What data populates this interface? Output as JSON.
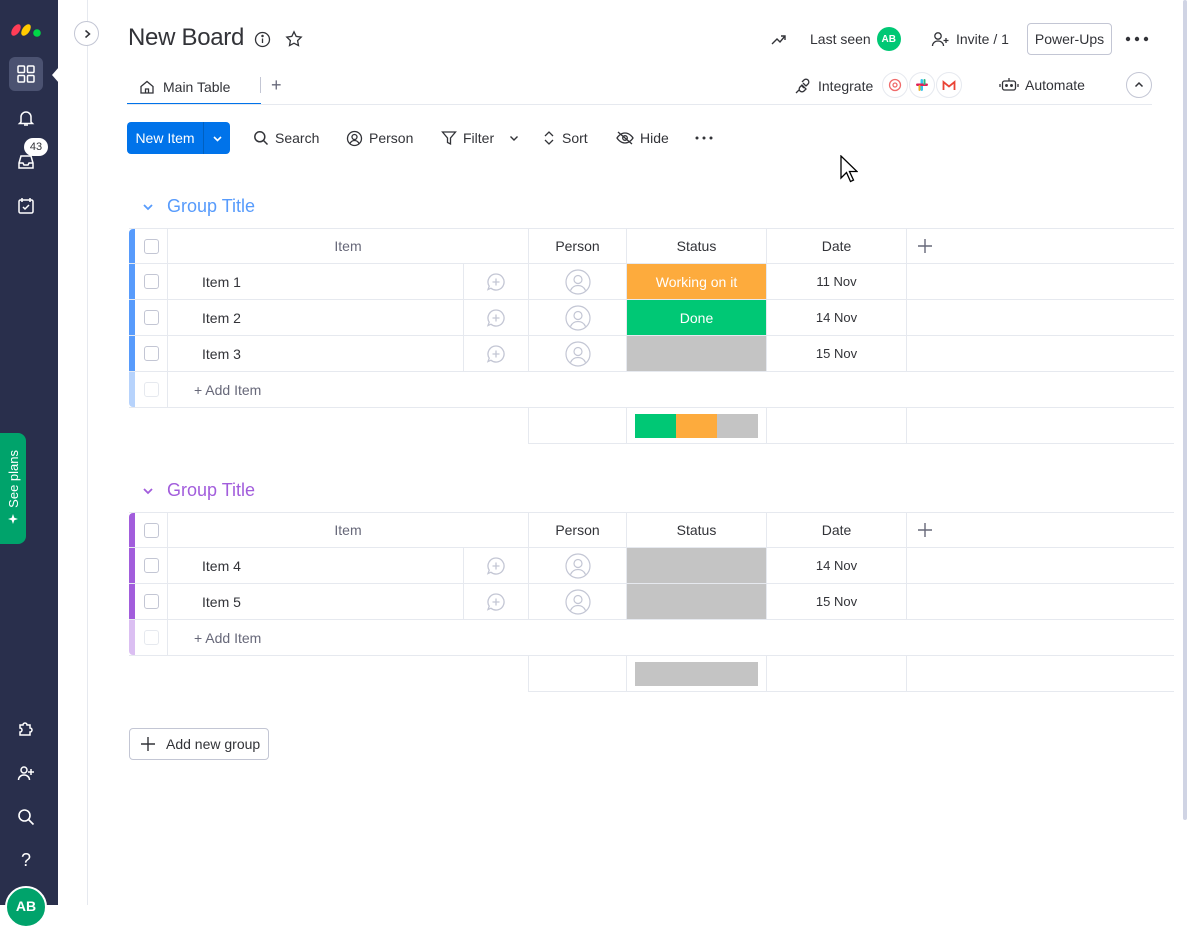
{
  "sidebar": {
    "logo": "monday-logo",
    "items": [
      {
        "name": "workspace-grid-icon",
        "active": true
      },
      {
        "name": "bell-icon"
      },
      {
        "name": "inbox-icon",
        "badge": "43"
      },
      {
        "name": "my-work-calendar-icon"
      }
    ],
    "see_plans": "See plans",
    "bottom_items": [
      "puzzle-icon",
      "invite-members-icon",
      "search-icon",
      "help-icon"
    ],
    "avatar_initials": "AB"
  },
  "board": {
    "title": "New Board",
    "last_seen_label": "Last seen",
    "last_seen_avatar": "AB",
    "invite_label": "Invite / 1",
    "power_ups_label": "Power-Ups"
  },
  "tabs": {
    "main_label": "Main Table",
    "add_label": "+",
    "integrate_label": "Integrate",
    "automate_label": "Automate"
  },
  "toolbar": {
    "new_item": "New Item",
    "search": "Search",
    "person": "Person",
    "filter": "Filter",
    "sort": "Sort",
    "hide": "Hide"
  },
  "columns": {
    "item": "Item",
    "person": "Person",
    "status": "Status",
    "date": "Date"
  },
  "groups": [
    {
      "title": "Group Title",
      "color": "#579bfc",
      "add_item": "+ Add Item",
      "rows": [
        {
          "name": "Item 1",
          "status": "Working on it",
          "status_color": "#fdab3d",
          "date": "11 Nov"
        },
        {
          "name": "Item 2",
          "status": "Done",
          "status_color": "#00c875",
          "date": "14 Nov"
        },
        {
          "name": "Item 3",
          "status": "",
          "status_color": "#c4c4c4",
          "date": "15 Nov"
        }
      ],
      "status_summary": [
        {
          "color": "#00c875",
          "fraction": 0.3333
        },
        {
          "color": "#fdab3d",
          "fraction": 0.3333
        },
        {
          "color": "#c4c4c4",
          "fraction": 0.3334
        }
      ]
    },
    {
      "title": "Group Title",
      "color": "#a25ddc",
      "add_item": "+ Add Item",
      "rows": [
        {
          "name": "Item 4",
          "status": "",
          "status_color": "#c4c4c4",
          "date": "14 Nov"
        },
        {
          "name": "Item 5",
          "status": "",
          "status_color": "#c4c4c4",
          "date": "15 Nov"
        }
      ],
      "status_summary": [
        {
          "color": "#c4c4c4",
          "fraction": 1.0
        }
      ]
    }
  ],
  "add_group_label": "Add new group"
}
